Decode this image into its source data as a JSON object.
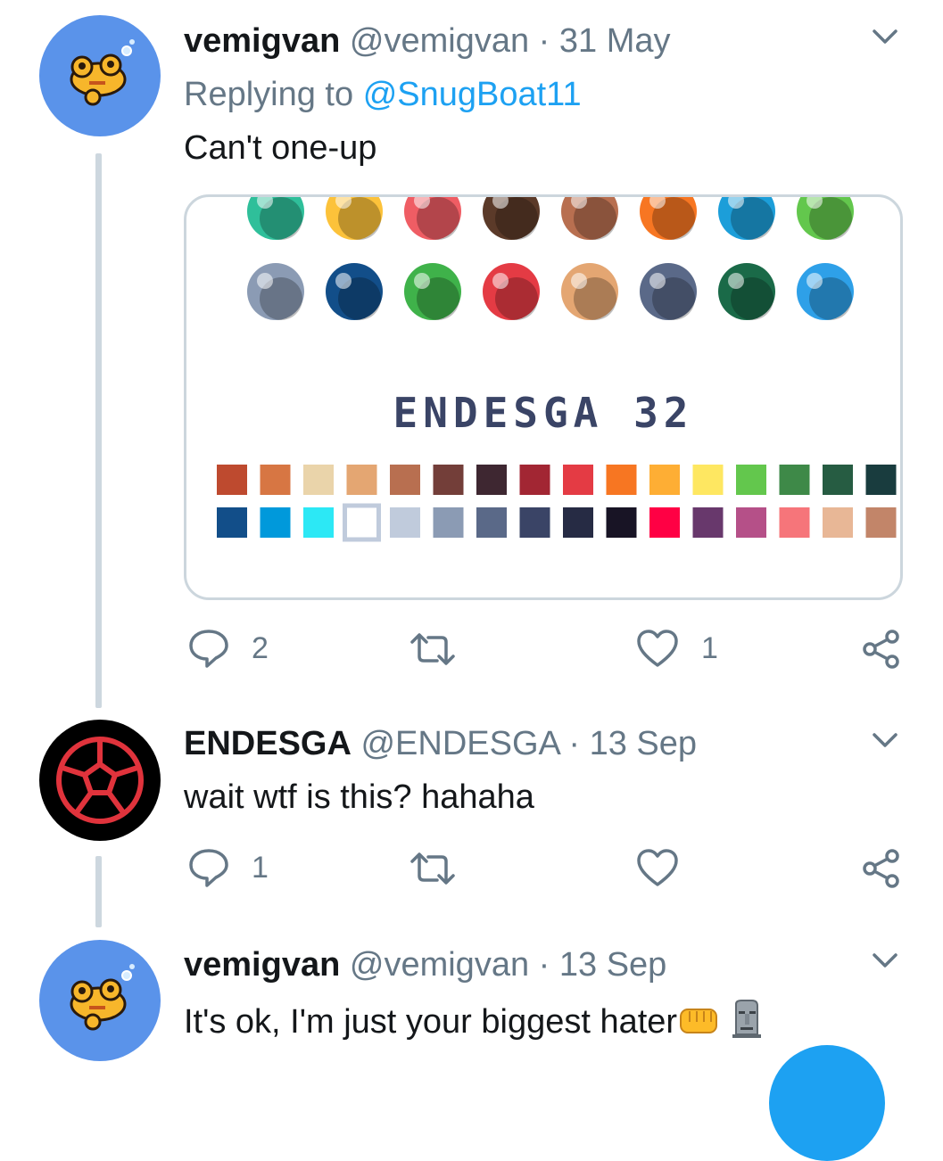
{
  "tweets": [
    {
      "name": "vemigvan",
      "handle": "@vemigvan",
      "separator": "·",
      "date": "31 May",
      "replying_prefix": "Replying to",
      "replying_to": "@SnugBoat11",
      "text": "Can't one-up",
      "media": {
        "title": "ENDESGA 32",
        "orbs_row1": [
          "#2fbf9a",
          "#fcc23a",
          "#ef5d64",
          "#5b3a29",
          "#b86f50",
          "#f77622",
          "#1c9ed9",
          "#63c74d"
        ],
        "orbs_row2": [
          "#8b9bb4",
          "#124e89",
          "#3fb24a",
          "#e43b44",
          "#e4a672",
          "#5a6988",
          "#1a6a48",
          "#2ea0e8"
        ],
        "palette_row1": [
          "#be4a2f",
          "#d77643",
          "#ead4aa",
          "#e4a672",
          "#b86f50",
          "#733e39",
          "#3e2731",
          "#a22633",
          "#e43b44",
          "#f77622",
          "#feae34",
          "#fee761",
          "#63c74d",
          "#3e8948",
          "#265c42",
          "#193c3e"
        ],
        "palette_row2": [
          "#124e89",
          "#0099db",
          "#2ce8f5",
          "#ffffff",
          "#c0cbdc",
          "#8b9bb4",
          "#5a6988",
          "#3a4466",
          "#262b44",
          "#181425",
          "#ff0044",
          "#68386c",
          "#b55088",
          "#f6757a",
          "#e8b796",
          "#c28569"
        ]
      },
      "actions": {
        "replies": "2",
        "retweets": "",
        "likes": "1"
      },
      "icons": {
        "reply": "reply-icon",
        "retweet": "retweet-icon",
        "like": "heart-icon",
        "share": "share-icon",
        "menu": "chevron-down-icon"
      }
    },
    {
      "name": "ENDESGA",
      "handle": "@ENDESGA",
      "separator": "·",
      "date": "13 Sep",
      "text": "wait wtf is this? hahaha",
      "actions": {
        "replies": "1",
        "retweets": "",
        "likes": ""
      },
      "icons": {
        "reply": "reply-icon",
        "retweet": "retweet-icon",
        "like": "heart-icon",
        "share": "share-icon",
        "menu": "chevron-down-icon"
      }
    },
    {
      "name": "vemigvan",
      "handle": "@vemigvan",
      "separator": "·",
      "date": "13 Sep",
      "text": "It's ok, I'm just your biggest hater",
      "emoji": [
        "oncoming-fist-emoji",
        "moai-emoji"
      ],
      "icons": {
        "menu": "chevron-down-icon"
      }
    }
  ],
  "colors": {
    "accent": "#1da1f2",
    "muted": "#657786",
    "thread_line": "#cdd7df",
    "avatar_blue": "#5a93ea"
  }
}
